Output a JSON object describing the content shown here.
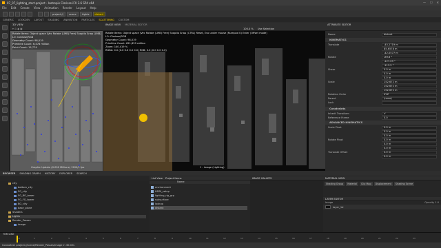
{
  "window": {
    "title": "07_07_lighting_start.project - Isotropix Clarisse iFX 3.6 SP4 x64",
    "controls": [
      "—",
      "☐",
      "✕"
    ]
  },
  "menu": [
    "File",
    "Edit",
    "Create",
    "View",
    "Animation",
    "Render",
    "Layout",
    "Help"
  ],
  "breadcrumbs": [
    "project://",
    "scene",
    "Lights",
    "distant"
  ],
  "workspace_tabs": [
    "GENERIC",
    "LOOKDEV",
    "LAYOUT",
    "SHADING",
    "ANIMATION",
    "PARTICLES",
    "SCATTERING",
    "CUSTOM"
  ],
  "active_workspace_index": 6,
  "view3d": {
    "tab": "3D VIEW",
    "overlay": [
      "Rotate Items: Object space (Vec Rotate (LMB) Free) Snaptio Snap (LMB)",
      "LO: Clarisse/RGB",
      "Geometry Count: 98,019",
      "Primitive Count: 6,478 million",
      "Point Count: 15,774"
    ],
    "footer": "Graphic Update (0.000 Millions) 1200/1 fps"
  },
  "imageview": {
    "tabs": [
      "IMAGE VIEW",
      "MATERIAL EDITOR"
    ],
    "zoom": "100.0 %",
    "selection": "Use Selection",
    "overlay": [
      "Rotate Items: Object space (Vec Rotate (LMB) Free) Snaptio Snap (CTRL) Reset, Evo under mouse (Numpad 0) Enter (Offset mode)",
      "LO: Clarisse/RGB",
      "Geometry Count: 98,019",
      "Primitive Count: 621,859 million",
      "Zoom: 140.419 %",
      "RGBA: 0.0 (0.0 0.0 0.0 0.0) RGB: 0.0 (0.0 0.0 0.0)"
    ],
    "footer": "1 - image (Lighting)"
  },
  "attribute_editor": {
    "tab": "ATTRIBUTE EDITOR",
    "name_label": "Name",
    "name_value": "distant",
    "sections": {
      "kinematics": "KINEMATICS",
      "constraints": "Constraints",
      "advanced": "ADVANCED KINEMATICS"
    },
    "rows": [
      {
        "label": "Translate",
        "value": "-45.2719 m"
      },
      {
        "label": "",
        "value": "85.6578 m"
      },
      {
        "label": "",
        "value": "-42.0577 m"
      },
      {
        "label": "Rotate",
        "value": "-89.6 °"
      },
      {
        "label": "",
        "value": "-127.09 °"
      },
      {
        "label": "",
        "value": "-113.5 °"
      },
      {
        "label": "Shear",
        "value": "0.0 m"
      },
      {
        "label": "",
        "value": "0.0 m"
      },
      {
        "label": "",
        "value": "0.0 m"
      },
      {
        "label": "Scale",
        "value": "152.672 m"
      },
      {
        "label": "",
        "value": "152.672 m"
      },
      {
        "label": "",
        "value": "152.672 m"
      },
      {
        "label": "Rotation Order",
        "value": "XYZ"
      },
      {
        "label": "Parent",
        "value": "(none)"
      },
      {
        "label": "Lock",
        "value": ""
      }
    ],
    "constraint_rows": [
      {
        "label": "Inherit Transform",
        "value": "✔"
      },
      {
        "label": "Reference Frame",
        "value": "0.0"
      }
    ],
    "advanced_rows": [
      {
        "label": "Scale Pivot",
        "value": "0.0 m"
      },
      {
        "label": "",
        "value": "0.0 m"
      },
      {
        "label": "",
        "value": "0.0 m"
      },
      {
        "label": "Rotate Pivot",
        "value": "0.0 m"
      },
      {
        "label": "",
        "value": "0.0 m"
      },
      {
        "label": "",
        "value": "0.0 m"
      },
      {
        "label": "Translate Offset",
        "value": "0.0 m"
      },
      {
        "label": "",
        "value": "0.0 m"
      }
    ]
  },
  "bottom_tabs": [
    "BROWSER",
    "SHADING GRAPH",
    "HISTORY",
    "EXPLORER",
    "SEARCH"
  ],
  "outliner": [
    {
      "label": "city",
      "depth": 1
    },
    {
      "label": "bottom_city",
      "depth": 2
    },
    {
      "label": "FG_city",
      "depth": 2
    },
    {
      "label": "FG_BG_tower",
      "depth": 2
    },
    {
      "label": "FG_FG_tower",
      "depth": 2
    },
    {
      "label": "BG_city",
      "depth": 2
    },
    {
      "label": "base_plane",
      "depth": 2
    },
    {
      "label": "Shaders",
      "depth": 1
    },
    {
      "label": "Lights",
      "depth": 1
    },
    {
      "label": "Render_Passes",
      "depth": 1
    },
    {
      "label": "image",
      "depth": 2
    }
  ],
  "filebrowser": {
    "filter": "List View",
    "project_item": "Project Items",
    "column": "Name",
    "items": [
      "environment",
      "HDRI_setup",
      "lighting_rig_grp",
      "subsurface",
      "lookup",
      "distant"
    ]
  },
  "image_gallery_tab": "IMAGE GALLERY",
  "material_view": {
    "tab": "MATERIAL VIEW",
    "chips": [
      "Shading Group",
      "Material",
      "Clip Map",
      "Displacement",
      "Shading Scene"
    ],
    "layer_tab": "LAYER EDITOR",
    "layer_cols": [
      "Image",
      "Opacity"
    ],
    "layer_name": "layer_1d",
    "opacity": "1.0"
  },
  "timeline": {
    "tab": "TIMELINE",
    "ticks": [
      "0.0",
      "1",
      "2",
      "3",
      "4",
      "5",
      "6",
      "7",
      "8",
      "9",
      "10",
      "11",
      "12",
      "13",
      "14",
      "15",
      "16",
      "17",
      "18",
      "19",
      "20",
      "21",
      "22",
      "23"
    ]
  },
  "status": "Consulted: project://scene/Render_Passes/image in 30.02s"
}
